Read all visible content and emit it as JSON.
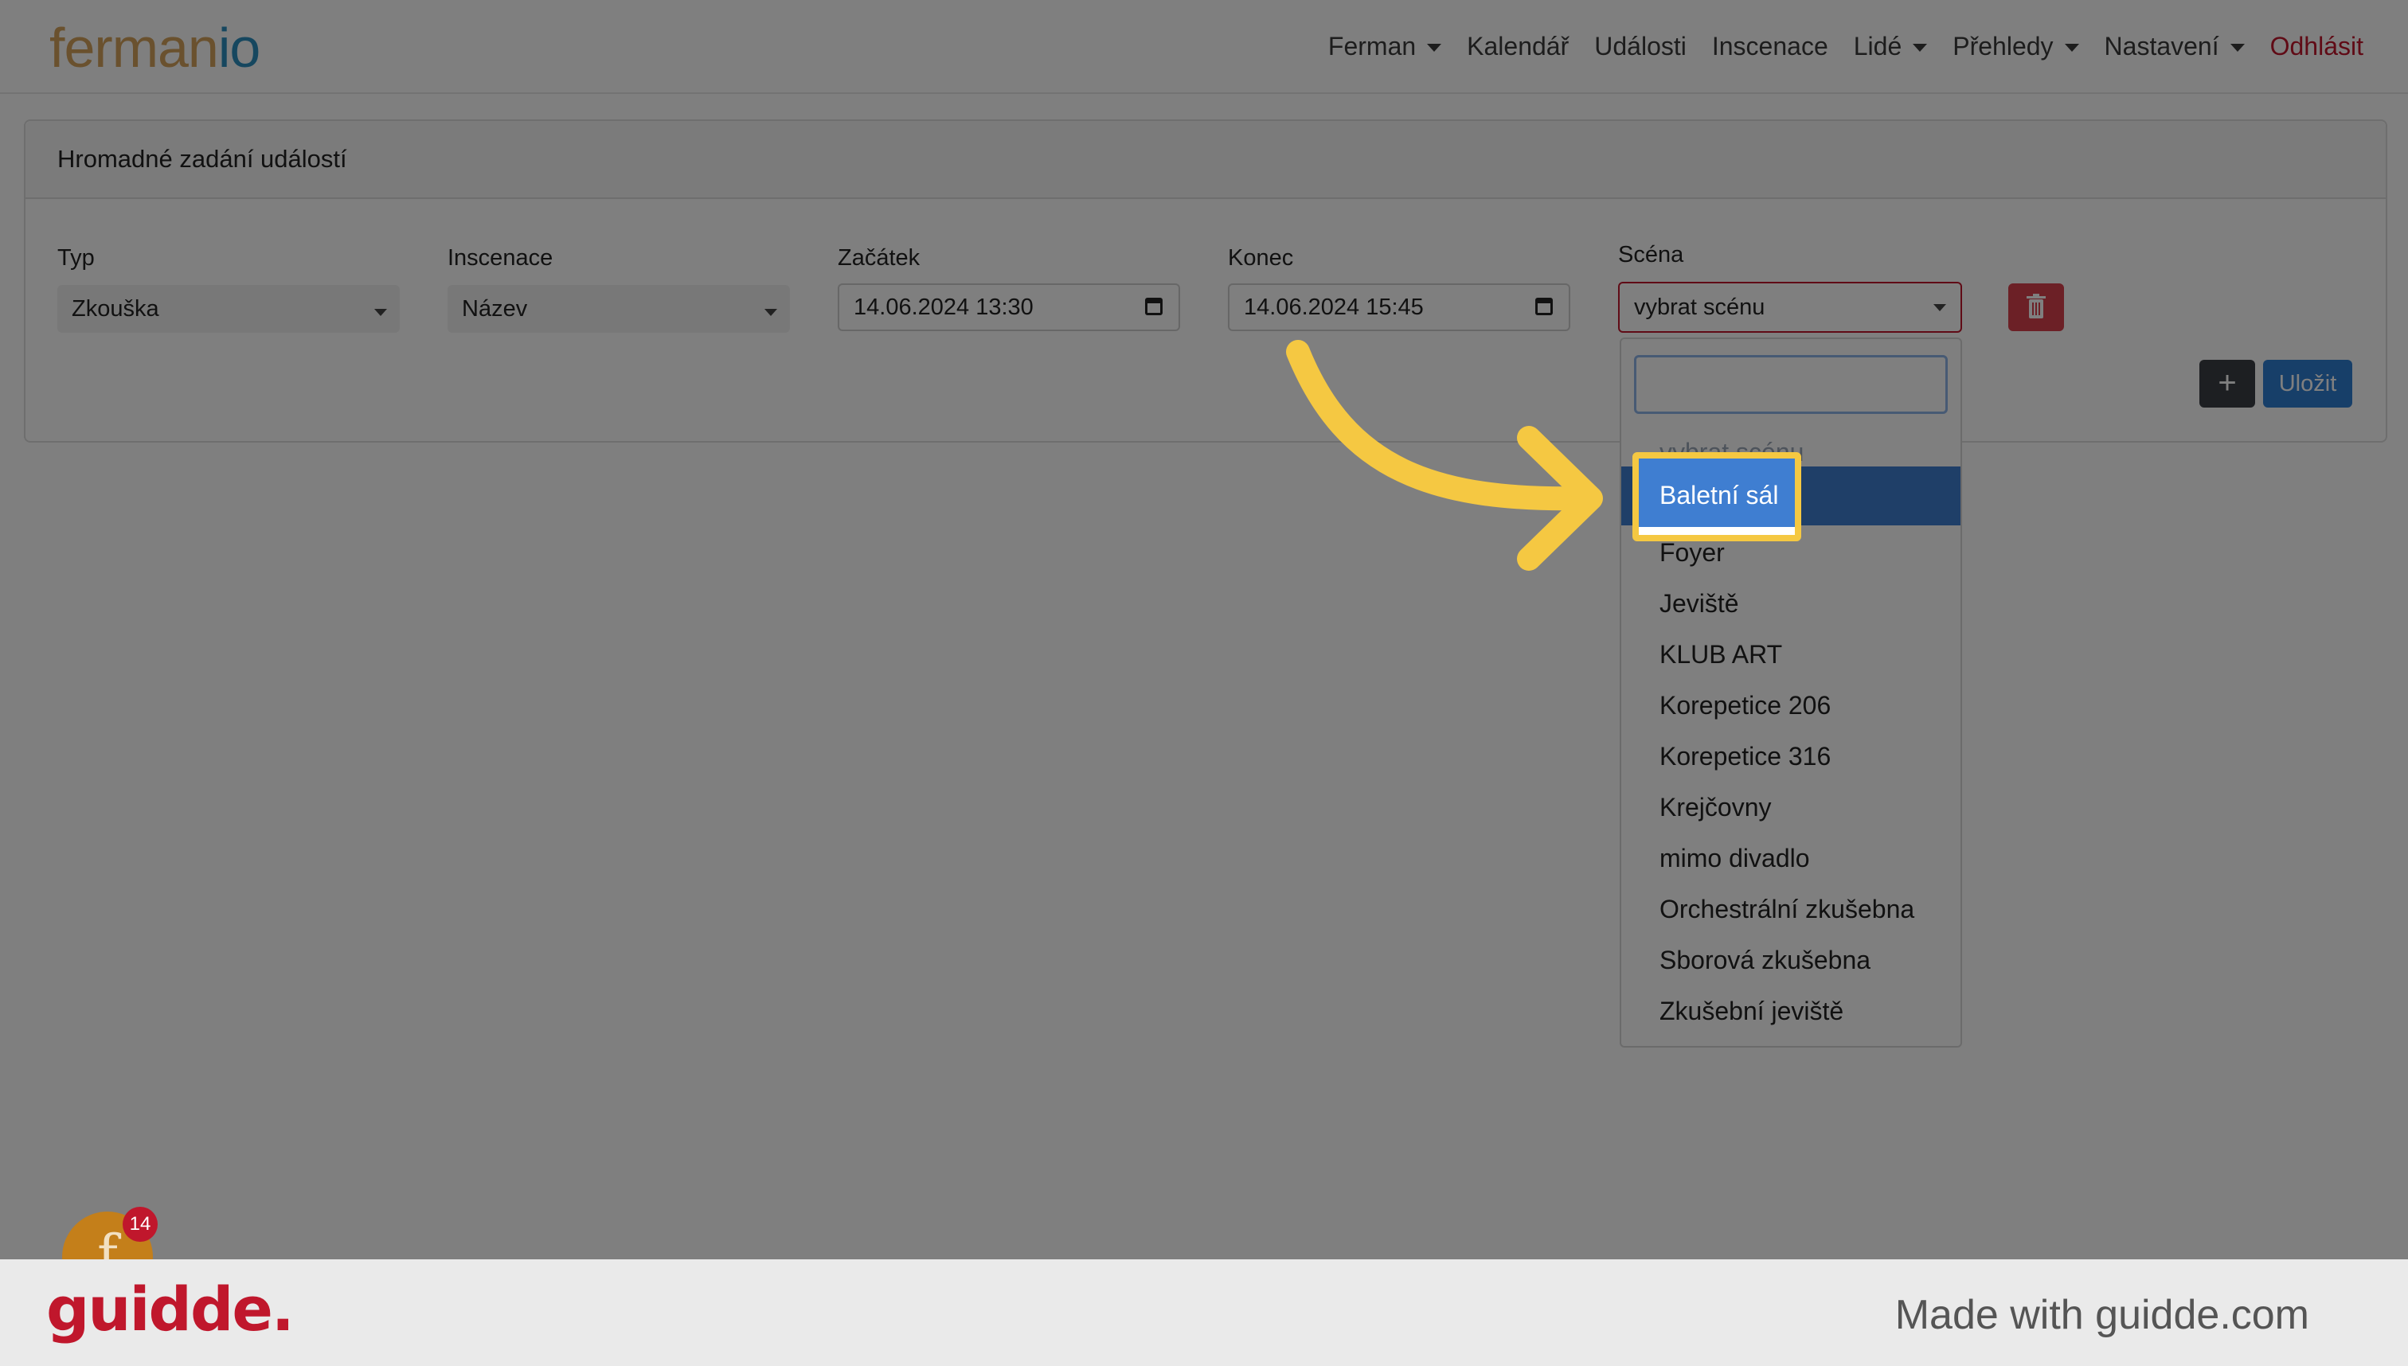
{
  "brand": {
    "part1": "ferman",
    "part2": "io"
  },
  "nav": {
    "items": [
      {
        "label": "Ferman",
        "dropdown": true
      },
      {
        "label": "Kalendář",
        "dropdown": false
      },
      {
        "label": "Události",
        "dropdown": false
      },
      {
        "label": "Inscenace",
        "dropdown": false
      },
      {
        "label": "Lidé",
        "dropdown": true
      },
      {
        "label": "Přehledy",
        "dropdown": true
      },
      {
        "label": "Nastavení",
        "dropdown": true
      }
    ],
    "logout": "Odhlásit"
  },
  "card": {
    "title": "Hromadné zadání událostí",
    "fields": {
      "typ": {
        "label": "Typ",
        "value": "Zkouška"
      },
      "inscenace": {
        "label": "Inscenace",
        "value": "Název"
      },
      "zacatek": {
        "label": "Začátek",
        "value": "14.06.2024 13:30"
      },
      "konec": {
        "label": "Konec",
        "value": "14.06.2024 15:45"
      },
      "scena": {
        "label": "Scéna",
        "value": "vybrat scénu"
      }
    },
    "add_label": "+",
    "save_label": "Uložit"
  },
  "dropdown": {
    "search_value": "",
    "options": [
      "vybrat scénu",
      "Baletní sál",
      "Foyer",
      "Jeviště",
      "KLUB ART",
      "Korepetice 206",
      "Korepetice 316",
      "Krejčovny",
      "mimo divadlo",
      "Orchestrální zkušebna",
      "Sborová zkušebna",
      "Zkušební jeviště"
    ],
    "highlighted": "Baletní sál"
  },
  "chat": {
    "avatar_letter": "f",
    "badge_count": "14"
  },
  "footer": {
    "logo": "guidde.",
    "made_with": "Made with guidde.com"
  },
  "colors": {
    "accent": "#f5c842",
    "danger": "#c0172c",
    "primary": "#2f7fd3"
  }
}
